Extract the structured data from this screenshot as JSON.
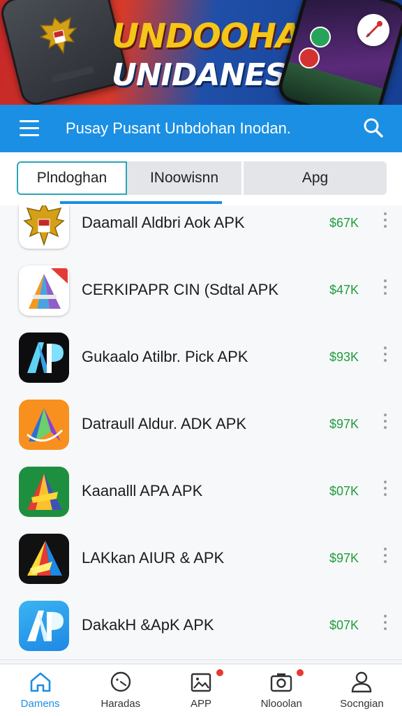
{
  "banner": {
    "title_line1": "UNDOOHAN",
    "title_line2": "UNIDANESIA"
  },
  "appbar": {
    "title": "Pusay Pusant Unbdohan Inodan."
  },
  "tabs": [
    {
      "label": "Plndoghan"
    },
    {
      "label": "INoowisnn"
    },
    {
      "label": "Apg"
    }
  ],
  "apps": [
    {
      "name": "Daamall Aldbri Aok APK",
      "size": "$67K",
      "icon": "garuda-emblem-icon"
    },
    {
      "name": "CERKIPAPR CIN (Sdtal APK",
      "size": "$47K",
      "icon": "prism-a-icon"
    },
    {
      "name": "Gukaalo Atilbr. Pick APK",
      "size": "$93K",
      "icon": "ap-dark-icon"
    },
    {
      "name": "Datraull Aldur. ADK APK",
      "size": "$97K",
      "icon": "orange-a-icon"
    },
    {
      "name": "Kaanalll APA APK",
      "size": "$07K",
      "icon": "green-a-icon"
    },
    {
      "name": "LAKkan AIUR & APK",
      "size": "$97K",
      "icon": "black-a-icon"
    },
    {
      "name": "DakakH &ApK APK",
      "size": "$07K",
      "icon": "ap-blue-icon"
    }
  ],
  "bottom_nav": [
    {
      "label": "Damens",
      "icon": "home-icon"
    },
    {
      "label": "Haradas",
      "icon": "clock-face-icon"
    },
    {
      "label": "APP",
      "icon": "image-icon"
    },
    {
      "label": "Nlooolan",
      "icon": "camera-icon"
    },
    {
      "label": "Socngian",
      "icon": "person-icon"
    }
  ],
  "colors": {
    "appbar": "#1a8fe3",
    "size_text": "#1f9d3d",
    "tab_active_border": "#2aa6b8",
    "active_nav": "#1a8fe3"
  }
}
